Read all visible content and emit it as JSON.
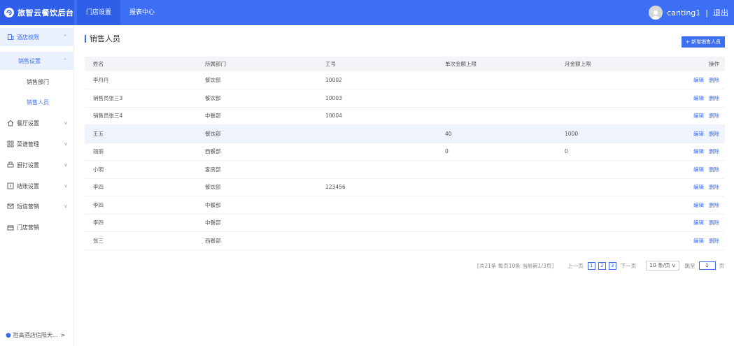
{
  "header": {
    "brand": "旅智云餐饮后台",
    "nav": [
      {
        "label": "门店设置"
      },
      {
        "label": "报表中心"
      }
    ],
    "username": "canting1",
    "separator": "|",
    "logout": "退出"
  },
  "sidebar": {
    "items": [
      {
        "label": "酒店权限",
        "arrow": "^"
      },
      {
        "label": "销售设置",
        "arrow": "^"
      },
      {
        "label": "销售部门"
      },
      {
        "label": "销售人员"
      },
      {
        "label": "餐厅设置",
        "arrow": "v"
      },
      {
        "label": "菜谱管理",
        "arrow": "v"
      },
      {
        "label": "厨打设置",
        "arrow": "v"
      },
      {
        "label": "结账设置",
        "arrow": "v"
      },
      {
        "label": "短信营销",
        "arrow": "v"
      },
      {
        "label": "门店营销"
      }
    ],
    "footer": "胜高酒店信阳天...",
    "footer_arrow": ">"
  },
  "main": {
    "title": "销售人员",
    "add_button": "+ 新增销售人员",
    "columns": [
      "姓名",
      "所属部门",
      "工号",
      "单次金额上限",
      "月金额上限",
      "操作"
    ],
    "rows": [
      {
        "name": "李丹丹",
        "dept": "餐饮部",
        "code": "10002",
        "single": "",
        "monthly": ""
      },
      {
        "name": "销售员张三3",
        "dept": "餐饮部",
        "code": "10003",
        "single": "",
        "monthly": ""
      },
      {
        "name": "销售员张三4",
        "dept": "中餐部",
        "code": "10004",
        "single": "",
        "monthly": ""
      },
      {
        "name": "王五",
        "dept": "餐饮部",
        "code": "",
        "single": "40",
        "monthly": "1000"
      },
      {
        "name": "丽丽",
        "dept": "西餐部",
        "code": "",
        "single": "0",
        "monthly": "0"
      },
      {
        "name": "小明",
        "dept": "客房部",
        "code": "",
        "single": "",
        "monthly": ""
      },
      {
        "name": "李四",
        "dept": "餐饮部",
        "code": "123456",
        "single": "",
        "monthly": ""
      },
      {
        "name": "李四",
        "dept": "中餐部",
        "code": "",
        "single": "",
        "monthly": ""
      },
      {
        "name": "李四",
        "dept": "中餐部",
        "code": "",
        "single": "",
        "monthly": ""
      },
      {
        "name": "张三",
        "dept": "西餐部",
        "code": "",
        "single": "",
        "monthly": ""
      }
    ],
    "edit_label": "编辑",
    "delete_label": "删除"
  },
  "pagination": {
    "info": "[共21条 每页10条 当前第1/3页]",
    "prev": "上一页",
    "pages": [
      "1",
      "2",
      "3"
    ],
    "next": "下一页",
    "page_size": "10 条/页 ∨",
    "jump_label": "跳至",
    "jump_value": "1",
    "page_unit": "页"
  },
  "colors": {
    "accent": "#3d6ff5",
    "header_dark": "#2f5ee8"
  }
}
